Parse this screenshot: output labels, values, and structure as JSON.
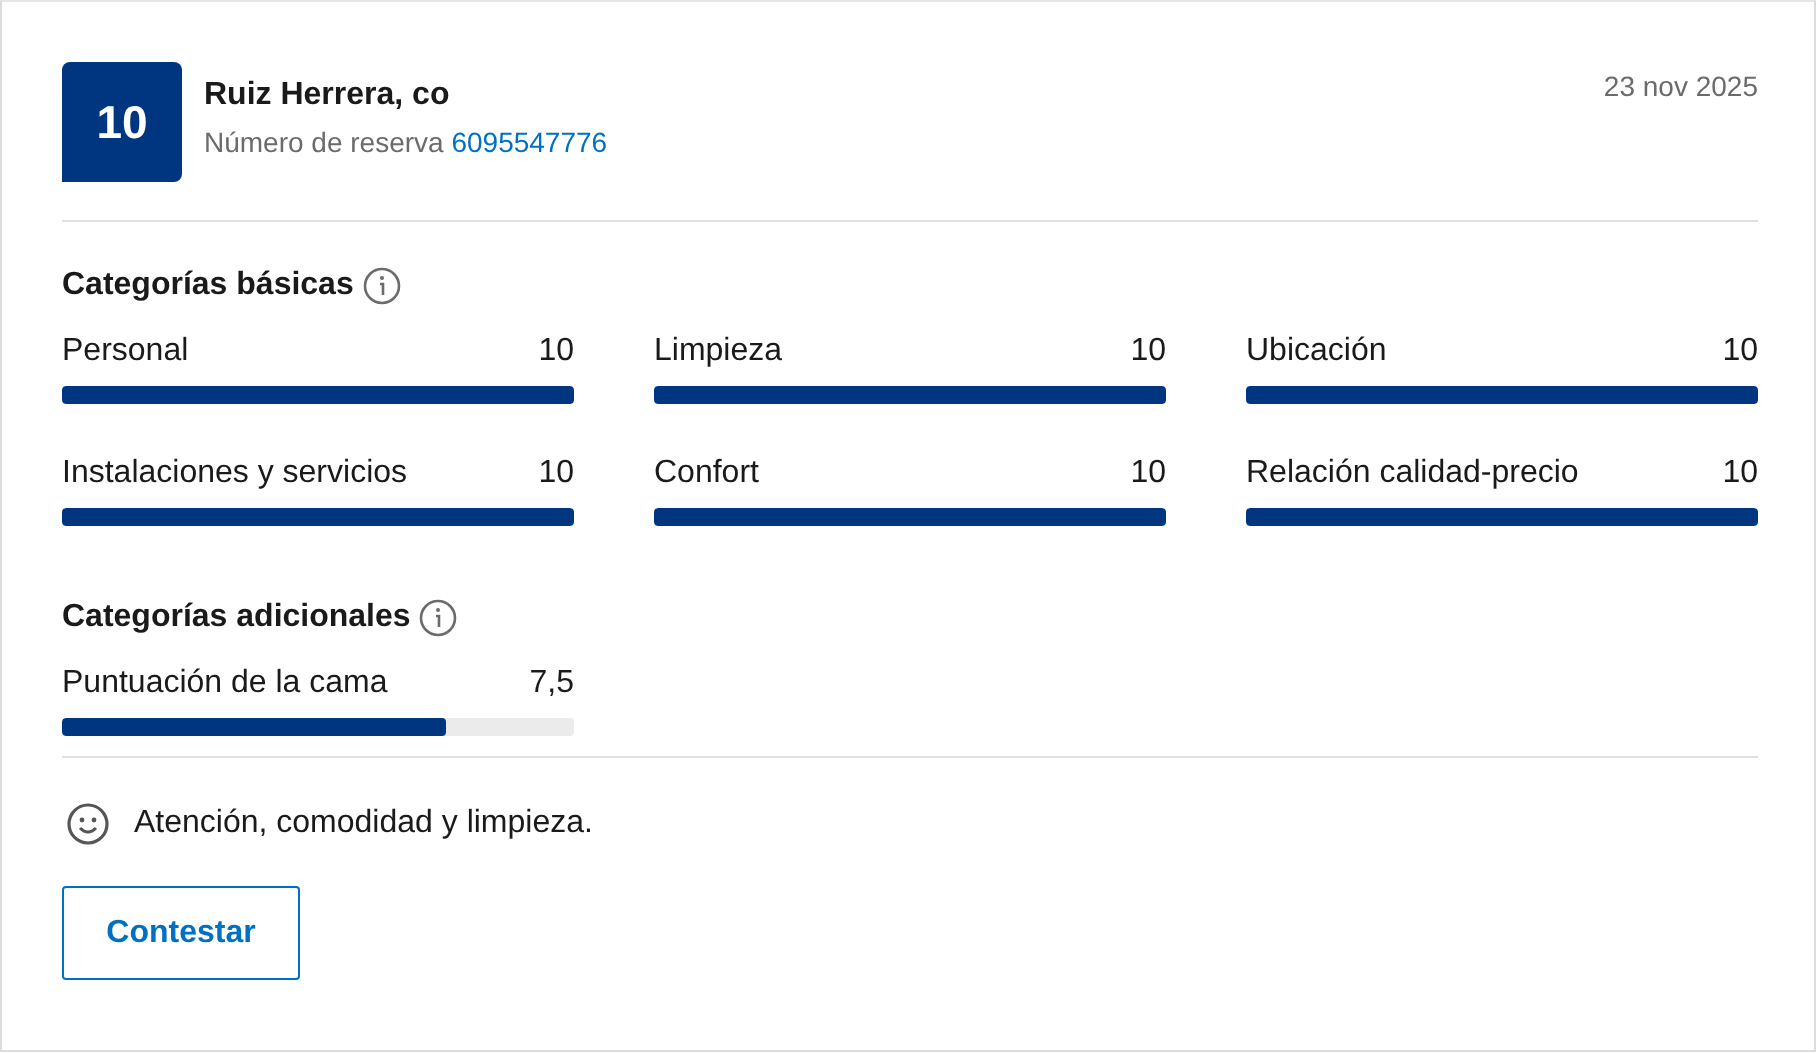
{
  "review": {
    "score": "10",
    "name": "Ruiz Herrera, co",
    "booking_label": "Número de reserva",
    "booking_number": "6095547776",
    "date": "23 nov 2025"
  },
  "sections": [
    {
      "title": "Categorías básicas",
      "items": [
        {
          "label": "Personal",
          "value": "10",
          "level": 1
        },
        {
          "label": "Limpieza",
          "value": "10",
          "level": 1
        },
        {
          "label": "Ubicación",
          "value": "10",
          "level": 1
        },
        {
          "label": "Instalaciones y servicios",
          "value": "10",
          "level": 1
        },
        {
          "label": "Confort",
          "value": "10",
          "level": 1
        },
        {
          "label": "Relación calidad-precio",
          "value": "10",
          "level": 1
        }
      ]
    },
    {
      "title": "Categorías adicionales",
      "items": [
        {
          "label": "Puntuación de la cama",
          "value": "7,5",
          "level": 0.75
        }
      ]
    }
  ],
  "comment": "Atención, comodidad y limpieza.",
  "reply_button": "Contestar"
}
